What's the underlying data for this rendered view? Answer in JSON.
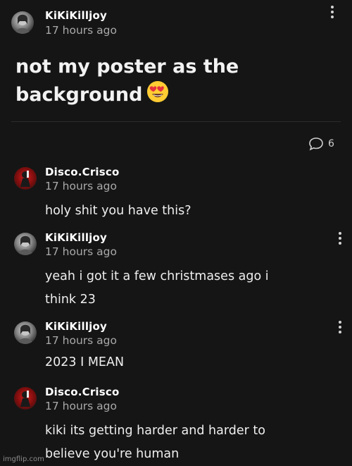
{
  "post": {
    "author": "KiKiKilljoy",
    "time": "17 hours ago",
    "title_line1": "not my poster as the",
    "title_line2": "background",
    "emoji_icon": "heart-eyes-emoji",
    "comment_count": "6"
  },
  "comments": [
    {
      "author": "Disco.Crisco",
      "time": "17 hours ago",
      "line1": "holy shit you have this?",
      "line2": ""
    },
    {
      "author": "KiKiKilljoy",
      "time": "17 hours ago",
      "line1": "yeah i got it a few christmases ago i",
      "line2": "think 23"
    },
    {
      "author": "KiKiKilljoy",
      "time": "17 hours ago",
      "line1": "2023 I MEAN",
      "line2": ""
    },
    {
      "author": "Disco.Crisco",
      "time": "17 hours ago",
      "line1": "kiki its getting harder and harder to",
      "line2": "believe you're human"
    }
  ],
  "watermark": "imgflip.com",
  "colors": {
    "background": "#151515",
    "text": "#e9e9e9",
    "muted": "#a9a9a9",
    "disco_avatar": "#d31b1b"
  }
}
